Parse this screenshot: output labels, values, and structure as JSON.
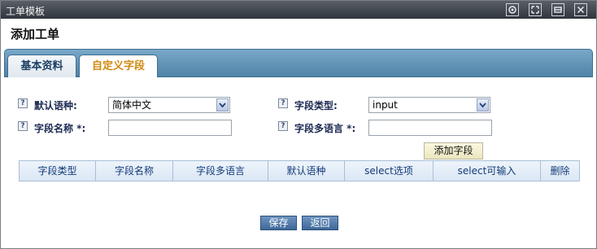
{
  "window": {
    "title": "工单模板",
    "controls": [
      {
        "name": "settings-icon"
      },
      {
        "name": "maximize-icon"
      },
      {
        "name": "minimize-icon"
      },
      {
        "name": "close-icon",
        "glyph": "×"
      }
    ]
  },
  "page_title": "添加工单",
  "tabs": [
    {
      "label": "基本资料",
      "active": false
    },
    {
      "label": "自定义字段",
      "active": true
    }
  ],
  "form": {
    "default_language_label": "默认语种:",
    "default_language_value": "简体中文",
    "field_type_label": "字段类型:",
    "field_type_value": "input",
    "field_name_label": "字段名称 *:",
    "field_name_value": "",
    "field_multilang_label": "字段多语言 *:",
    "field_multilang_value": "",
    "help_glyph": "?",
    "add_field_button": "添加字段"
  },
  "table": {
    "headers": [
      "字段类型",
      "字段名称",
      "字段多语言",
      "默认语种",
      "select选项",
      "select可输入",
      "删除"
    ]
  },
  "buttons": {
    "save": "保存",
    "back": "返回"
  },
  "colors": {
    "tab_bar": "#5b8db3",
    "active_tab_text": "#d08a10",
    "label_text": "#1c2a52",
    "button_blue": "#4a74a3"
  }
}
